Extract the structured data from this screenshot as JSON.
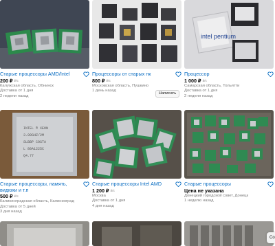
{
  "listings": [
    {
      "title": "Старые процессоры AMD/Intel",
      "price": "200 ₽",
      "price_tag": "₽/с",
      "location": "Калужская область, Обнинск",
      "delivery": "Доставка от 1 дня",
      "date": "2 недели назад"
    },
    {
      "title": "Процессоры от старых пк",
      "price": "800 ₽",
      "price_tag": "₽/с",
      "location": "Московская область, Пушкино",
      "date": "1 день назад",
      "write_button": "Написать"
    },
    {
      "title": "Процессор",
      "price": "1 000 ₽",
      "price_tag": "₽/с",
      "location": "Самарская область, Тольятти",
      "delivery": "Доставка от 1 дня",
      "date": "2 недели назад",
      "chip_text": "intel pentium"
    },
    {
      "title": "Старые процессоры, память, видюхи и т.п",
      "price": "500 ₽",
      "price_tag": "₽/с",
      "location": "Калининградская область, Калининград",
      "delivery": "Доставка от 5 дней",
      "date": "3 дня назад"
    },
    {
      "title": "Старые процессоры Intel AMD",
      "price": "1 200 ₽",
      "price_tag": "₽/с",
      "location": "Москва",
      "delivery": "Доставка от 1 дня",
      "date": "4 дня назад"
    },
    {
      "title": "Старые процессоры",
      "price": "Цена не указана",
      "location": "Донецкий городской совет, Донецк",
      "date": "1 неделю назад"
    }
  ],
  "float_button_label": "Co",
  "colors": {
    "link": "#0a6dc2",
    "heart": "#0a6dc2",
    "meta": "#7a7a7a"
  },
  "icons": [
    "heart-icon"
  ]
}
